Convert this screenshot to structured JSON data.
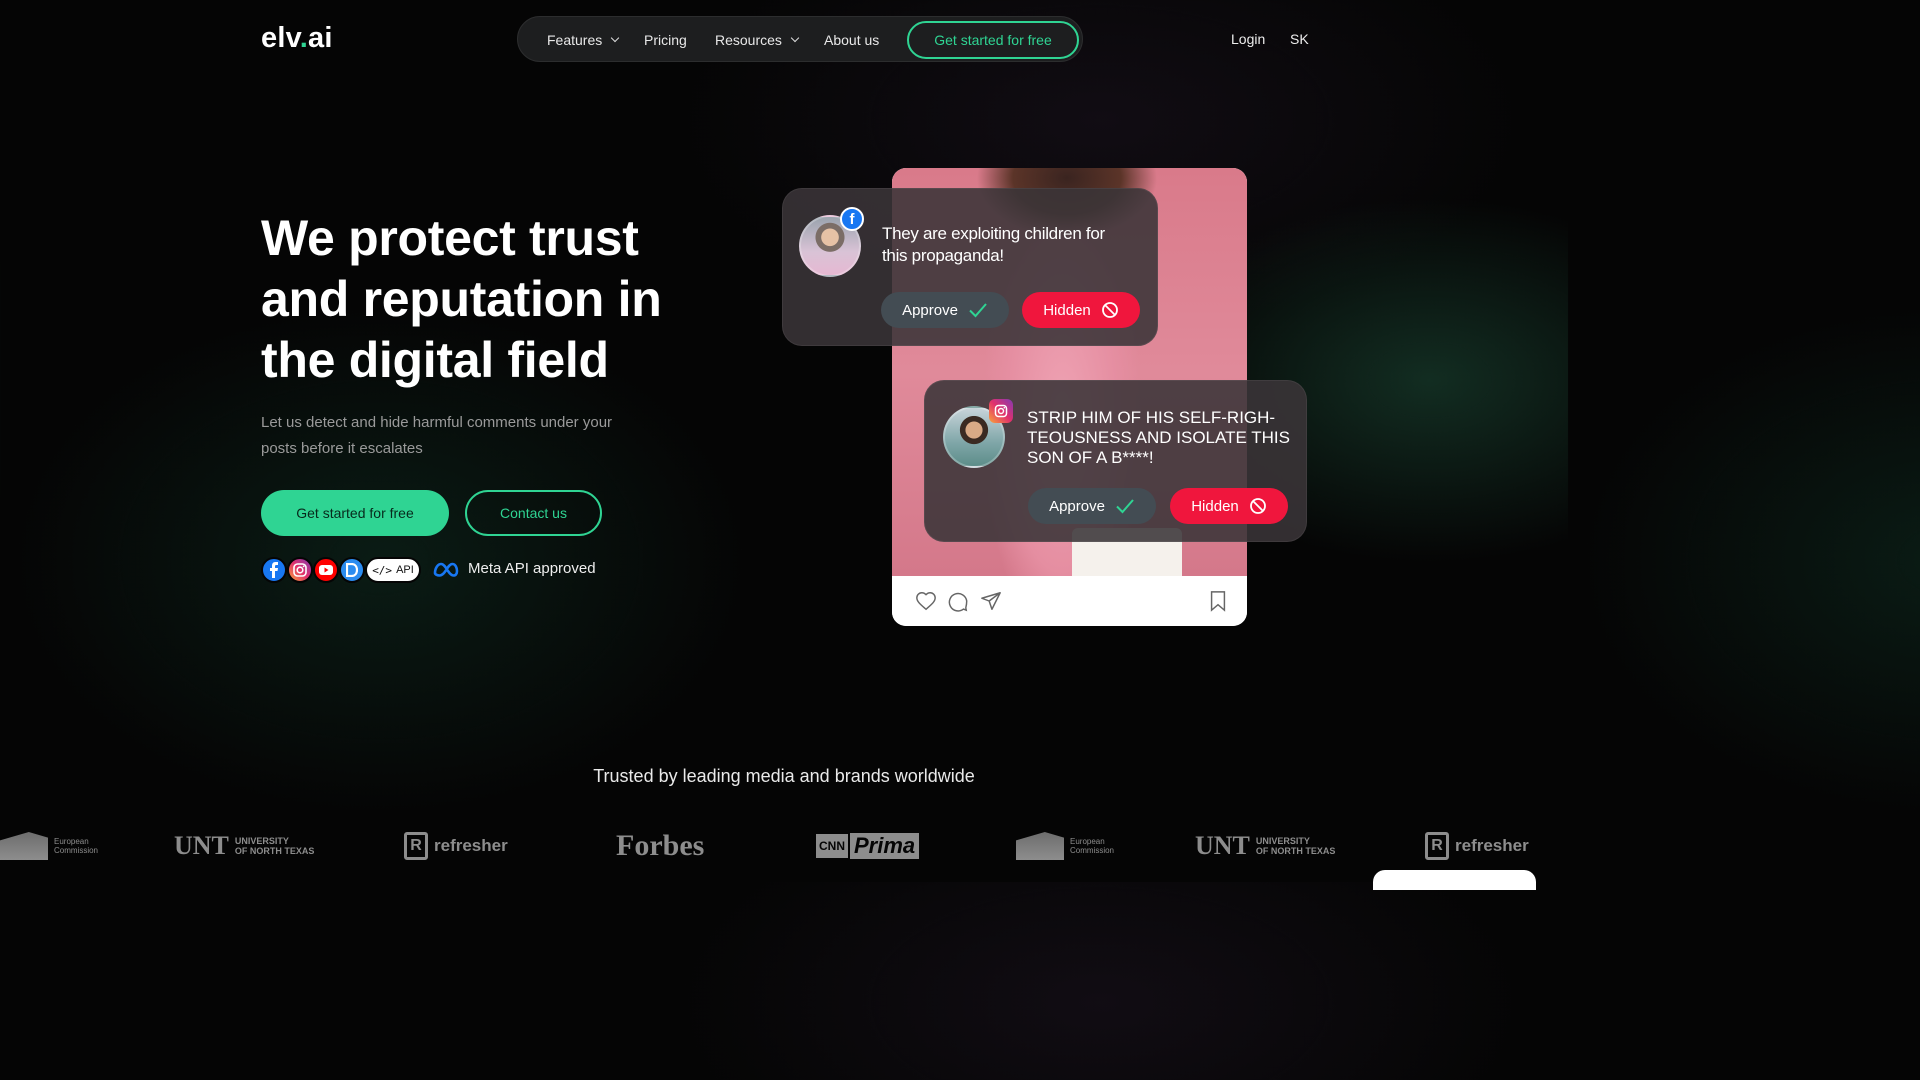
{
  "brand": {
    "logo_prefix": "elv",
    "logo_dot": ".",
    "logo_suffix": "ai",
    "accent": "#2fd493"
  },
  "nav": {
    "items": [
      {
        "label": "Features",
        "dropdown": true
      },
      {
        "label": "Pricing",
        "dropdown": false
      },
      {
        "label": "Resources",
        "dropdown": true
      },
      {
        "label": "About us",
        "dropdown": false
      }
    ],
    "cta": "Get started for free",
    "login": "Login",
    "language": "SK"
  },
  "hero": {
    "title": "We protect trust and reputation in the digital field",
    "subtitle": "Let us detect and hide harmful comments under your posts before it escalates",
    "primary_button": "Get started for free",
    "secondary_button": "Contact us",
    "platform_icons": [
      "facebook-icon",
      "instagram-icon",
      "youtube-icon",
      "d-icon"
    ],
    "api_label": "API",
    "meta_label": "Meta API approved"
  },
  "mockup": {
    "comments": [
      {
        "platform": "facebook",
        "text": "They are exploiting children for this propaganda!",
        "approve": "Approve",
        "hide": "Hidden"
      },
      {
        "platform": "instagram",
        "text": "STRIP HIM OF HIS SELF-RIGH-TEOUSNESS AND ISOLATE THIS SON OF A B****!",
        "approve": "Approve",
        "hide": "Hidden"
      }
    ],
    "post_actions": [
      "heart-icon",
      "comment-icon",
      "share-icon",
      "bookmark-icon"
    ]
  },
  "trusted": {
    "heading": "Trusted by leading media and brands worldwide",
    "logos": {
      "european_commission": [
        "European",
        "Commission"
      ],
      "unt": {
        "mark": "UNT",
        "line1": "UNIVERSITY",
        "line2": "OF NORTH TEXAS"
      },
      "refresher": {
        "mark": "R",
        "name": "refresher"
      },
      "forbes": "Forbes",
      "cnn_prima": {
        "cnn": "CNN",
        "prima": "Prima"
      }
    }
  }
}
